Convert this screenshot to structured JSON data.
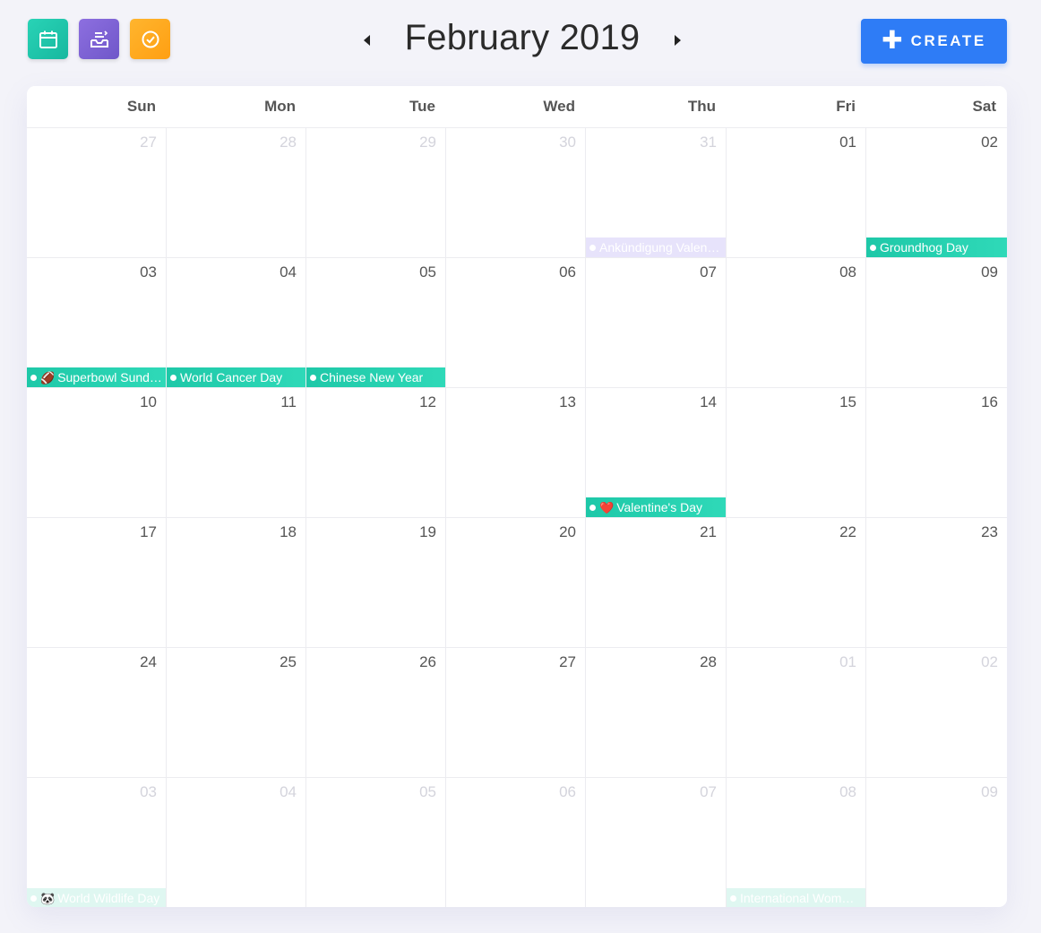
{
  "toolbar": {
    "view_buttons": [
      {
        "name": "calendar-view",
        "icon": "calendar-icon",
        "color": "#1ec8a8"
      },
      {
        "name": "inbox-view",
        "icon": "inbox-icon",
        "color": "#7c63d6"
      },
      {
        "name": "tasks-view",
        "icon": "check-circle-icon",
        "color": "#ffa91f"
      }
    ],
    "prev_icon": "chevron-left-icon",
    "next_icon": "chevron-right-icon",
    "month_title": "February 2019",
    "create_label": "CREATE",
    "create_icon": "plus-icon",
    "create_color": "#2e7cf6"
  },
  "weekdays": [
    "Sun",
    "Mon",
    "Tue",
    "Wed",
    "Thu",
    "Fri",
    "Sat"
  ],
  "weeks": [
    [
      {
        "day": "27",
        "other": true
      },
      {
        "day": "28",
        "other": true
      },
      {
        "day": "29",
        "other": true
      },
      {
        "day": "30",
        "other": true
      },
      {
        "day": "31",
        "other": true,
        "event": {
          "label": "Ankündigung Valen…",
          "style": "lavender"
        }
      },
      {
        "day": "01"
      },
      {
        "day": "02",
        "event": {
          "label": "Groundhog Day"
        }
      }
    ],
    [
      {
        "day": "03",
        "event": {
          "label": "Superbowl Sund…",
          "icon": "🏈"
        }
      },
      {
        "day": "04",
        "event": {
          "label": "World Cancer Day"
        }
      },
      {
        "day": "05",
        "event": {
          "label": "Chinese New Year"
        }
      },
      {
        "day": "06"
      },
      {
        "day": "07"
      },
      {
        "day": "08"
      },
      {
        "day": "09"
      }
    ],
    [
      {
        "day": "10"
      },
      {
        "day": "11"
      },
      {
        "day": "12"
      },
      {
        "day": "13"
      },
      {
        "day": "14",
        "event": {
          "label": "Valentine's Day",
          "icon": "❤️"
        }
      },
      {
        "day": "15"
      },
      {
        "day": "16"
      }
    ],
    [
      {
        "day": "17"
      },
      {
        "day": "18"
      },
      {
        "day": "19"
      },
      {
        "day": "20"
      },
      {
        "day": "21"
      },
      {
        "day": "22"
      },
      {
        "day": "23"
      }
    ],
    [
      {
        "day": "24"
      },
      {
        "day": "25"
      },
      {
        "day": "26"
      },
      {
        "day": "27"
      },
      {
        "day": "28"
      },
      {
        "day": "01",
        "other": true
      },
      {
        "day": "02",
        "other": true
      }
    ],
    [
      {
        "day": "03",
        "other": true,
        "event": {
          "label": "World Wildlife Day",
          "icon": "🐼",
          "style": "faded"
        }
      },
      {
        "day": "04",
        "other": true
      },
      {
        "day": "05",
        "other": true
      },
      {
        "day": "06",
        "other": true
      },
      {
        "day": "07",
        "other": true
      },
      {
        "day": "08",
        "other": true,
        "event": {
          "label": "International Wom…",
          "style": "faded"
        }
      },
      {
        "day": "09",
        "other": true
      }
    ]
  ]
}
